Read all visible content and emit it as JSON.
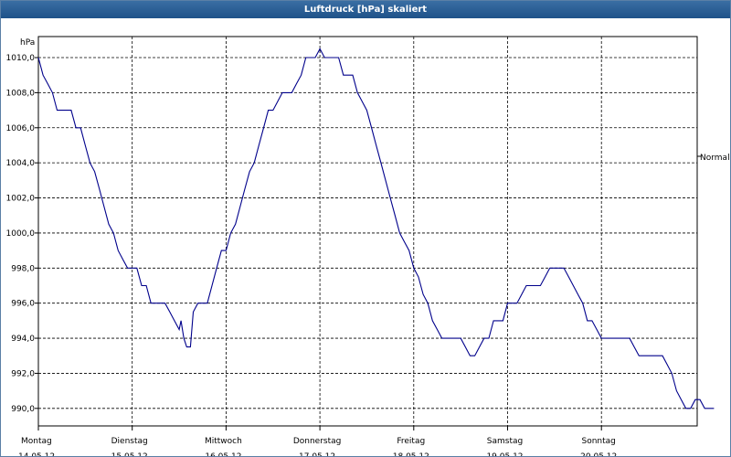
{
  "window": {
    "title": "Luftdruck [hPa] skaliert"
  },
  "chart_data": {
    "type": "line",
    "title": "Luftdruck [hPa] skaliert",
    "unit_label": "hPa",
    "reference_label": "Normal",
    "ylim": [
      989.0,
      1011.2
    ],
    "yticks": [
      "1010,0",
      "1008,0",
      "1006,0",
      "1004,0",
      "1002,0",
      "1000,0",
      "998,0",
      "996,0",
      "994,0",
      "992,0",
      "990,0"
    ],
    "ytick_values": [
      1010,
      1008,
      1006,
      1004,
      1002,
      1000,
      998,
      996,
      994,
      992,
      990
    ],
    "grid": true,
    "days": [
      {
        "name": "Montag",
        "date": "14.05.12"
      },
      {
        "name": "Dienstag",
        "date": "15.05.12"
      },
      {
        "name": "Mittwoch",
        "date": "16.05.12"
      },
      {
        "name": "Donnerstag",
        "date": "17.05.12"
      },
      {
        "name": "Freitag",
        "date": "18.05.12"
      },
      {
        "name": "Samstag",
        "date": "19.05.12"
      },
      {
        "name": "Sonntag",
        "date": "20.05.12"
      }
    ],
    "series": [
      {
        "color": "#00008b",
        "points": [
          [
            0.0,
            1010.0
          ],
          [
            0.05,
            1009.0
          ],
          [
            0.1,
            1008.5
          ],
          [
            0.15,
            1008.0
          ],
          [
            0.2,
            1007.0
          ],
          [
            0.25,
            1007.0
          ],
          [
            0.3,
            1007.0
          ],
          [
            0.35,
            1007.0
          ],
          [
            0.4,
            1006.0
          ],
          [
            0.45,
            1006.0
          ],
          [
            0.5,
            1005.0
          ],
          [
            0.55,
            1004.0
          ],
          [
            0.6,
            1003.5
          ],
          [
            0.65,
            1002.5
          ],
          [
            0.7,
            1001.5
          ],
          [
            0.75,
            1000.5
          ],
          [
            0.8,
            1000.0
          ],
          [
            0.85,
            999.0
          ],
          [
            0.9,
            998.5
          ],
          [
            0.95,
            998.0
          ],
          [
            1.0,
            998.0
          ],
          [
            1.05,
            998.0
          ],
          [
            1.1,
            997.0
          ],
          [
            1.15,
            997.0
          ],
          [
            1.2,
            996.0
          ],
          [
            1.25,
            996.0
          ],
          [
            1.3,
            996.0
          ],
          [
            1.35,
            996.0
          ],
          [
            1.4,
            995.5
          ],
          [
            1.45,
            995.0
          ],
          [
            1.5,
            994.5
          ],
          [
            1.52,
            995.0
          ],
          [
            1.55,
            994.0
          ],
          [
            1.58,
            993.5
          ],
          [
            1.62,
            993.5
          ],
          [
            1.65,
            995.5
          ],
          [
            1.7,
            996.0
          ],
          [
            1.75,
            996.0
          ],
          [
            1.8,
            996.0
          ],
          [
            1.85,
            997.0
          ],
          [
            1.9,
            998.0
          ],
          [
            1.95,
            999.0
          ],
          [
            2.0,
            999.0
          ],
          [
            2.05,
            1000.0
          ],
          [
            2.1,
            1000.5
          ],
          [
            2.15,
            1001.5
          ],
          [
            2.2,
            1002.5
          ],
          [
            2.25,
            1003.5
          ],
          [
            2.3,
            1004.0
          ],
          [
            2.35,
            1005.0
          ],
          [
            2.4,
            1006.0
          ],
          [
            2.45,
            1007.0
          ],
          [
            2.5,
            1007.0
          ],
          [
            2.55,
            1007.5
          ],
          [
            2.6,
            1008.0
          ],
          [
            2.65,
            1008.0
          ],
          [
            2.7,
            1008.0
          ],
          [
            2.75,
            1008.5
          ],
          [
            2.8,
            1009.0
          ],
          [
            2.85,
            1010.0
          ],
          [
            2.9,
            1010.0
          ],
          [
            2.95,
            1010.0
          ],
          [
            3.0,
            1010.5
          ],
          [
            3.05,
            1010.0
          ],
          [
            3.1,
            1010.0
          ],
          [
            3.15,
            1010.0
          ],
          [
            3.2,
            1010.0
          ],
          [
            3.25,
            1009.0
          ],
          [
            3.3,
            1009.0
          ],
          [
            3.35,
            1009.0
          ],
          [
            3.4,
            1008.0
          ],
          [
            3.45,
            1007.5
          ],
          [
            3.5,
            1007.0
          ],
          [
            3.55,
            1006.0
          ],
          [
            3.6,
            1005.0
          ],
          [
            3.65,
            1004.0
          ],
          [
            3.7,
            1003.0
          ],
          [
            3.75,
            1002.0
          ],
          [
            3.8,
            1001.0
          ],
          [
            3.85,
            1000.0
          ],
          [
            3.9,
            999.5
          ],
          [
            3.95,
            999.0
          ],
          [
            4.0,
            998.0
          ],
          [
            4.05,
            997.5
          ],
          [
            4.1,
            996.5
          ],
          [
            4.15,
            996.0
          ],
          [
            4.2,
            995.0
          ],
          [
            4.25,
            994.5
          ],
          [
            4.3,
            994.0
          ],
          [
            4.35,
            994.0
          ],
          [
            4.4,
            994.0
          ],
          [
            4.45,
            994.0
          ],
          [
            4.5,
            994.0
          ],
          [
            4.55,
            993.5
          ],
          [
            4.6,
            993.0
          ],
          [
            4.65,
            993.0
          ],
          [
            4.7,
            993.5
          ],
          [
            4.75,
            994.0
          ],
          [
            4.8,
            994.0
          ],
          [
            4.85,
            995.0
          ],
          [
            4.9,
            995.0
          ],
          [
            4.95,
            995.0
          ],
          [
            5.0,
            996.0
          ],
          [
            5.05,
            996.0
          ],
          [
            5.1,
            996.0
          ],
          [
            5.15,
            996.5
          ],
          [
            5.2,
            997.0
          ],
          [
            5.25,
            997.0
          ],
          [
            5.3,
            997.0
          ],
          [
            5.35,
            997.0
          ],
          [
            5.4,
            997.5
          ],
          [
            5.45,
            998.0
          ],
          [
            5.5,
            998.0
          ],
          [
            5.55,
            998.0
          ],
          [
            5.6,
            998.0
          ],
          [
            5.65,
            997.5
          ],
          [
            5.7,
            997.0
          ],
          [
            5.75,
            996.5
          ],
          [
            5.8,
            996.0
          ],
          [
            5.85,
            995.0
          ],
          [
            5.9,
            995.0
          ],
          [
            5.95,
            994.5
          ],
          [
            6.0,
            994.0
          ],
          [
            6.05,
            994.0
          ],
          [
            6.1,
            994.0
          ],
          [
            6.15,
            994.0
          ],
          [
            6.2,
            994.0
          ],
          [
            6.25,
            994.0
          ],
          [
            6.3,
            994.0
          ],
          [
            6.35,
            993.5
          ],
          [
            6.4,
            993.0
          ],
          [
            6.45,
            993.0
          ],
          [
            6.5,
            993.0
          ],
          [
            6.55,
            993.0
          ],
          [
            6.6,
            993.0
          ],
          [
            6.65,
            993.0
          ],
          [
            6.7,
            992.5
          ],
          [
            6.75,
            992.0
          ],
          [
            6.8,
            991.0
          ],
          [
            6.85,
            990.5
          ],
          [
            6.9,
            990.0
          ],
          [
            6.95,
            990.0
          ],
          [
            7.0,
            990.5
          ],
          [
            7.05,
            990.5
          ],
          [
            7.1,
            990.0
          ],
          [
            7.15,
            990.0
          ],
          [
            7.2,
            990.0
          ]
        ]
      }
    ]
  }
}
